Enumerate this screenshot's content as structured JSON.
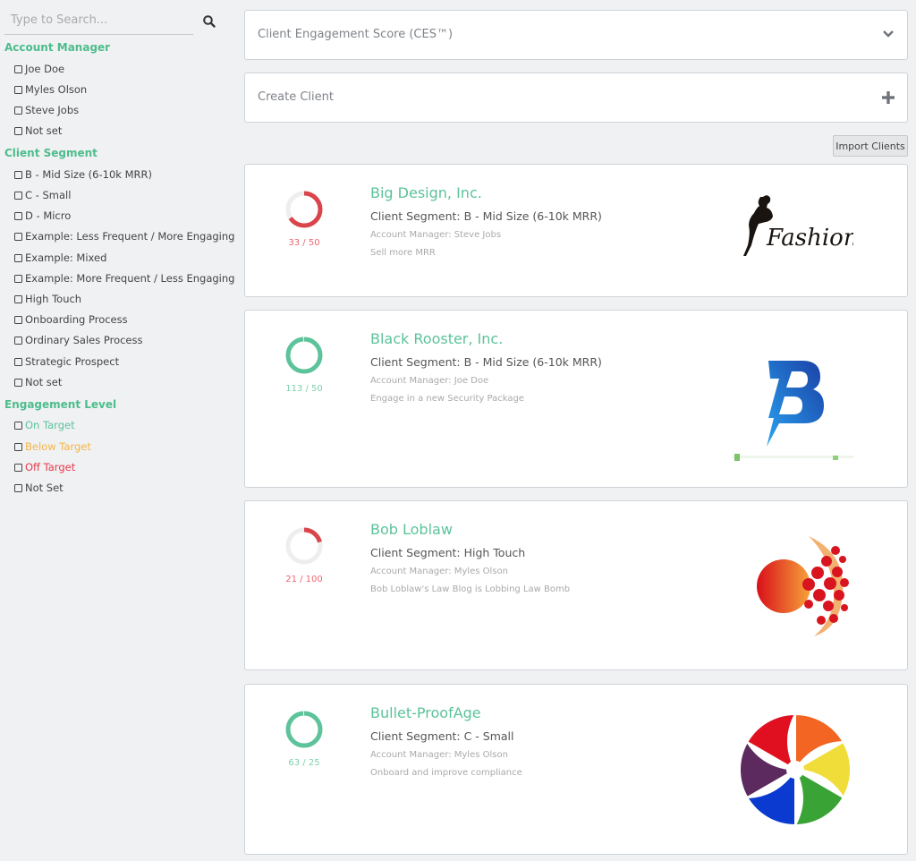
{
  "search": {
    "placeholder": "Type to Search..."
  },
  "filters": {
    "account_manager": {
      "title": "Account Manager",
      "items": [
        "Joe Doe",
        "Myles Olson",
        "Steve Jobs",
        "Not set"
      ]
    },
    "client_segment": {
      "title": "Client Segment",
      "items": [
        "B - Mid Size (6-10k MRR)",
        "C - Small",
        "D - Micro",
        "Example: Less Frequent / More Engaging",
        "Example: Mixed",
        "Example: More Frequent / Less Engaging",
        "High Touch",
        "Onboarding Process",
        "Ordinary Sales Process",
        "Strategic Prospect",
        "Not set"
      ]
    },
    "engagement_level": {
      "title": "Engagement Level",
      "items": [
        "On Target",
        "Below Target",
        "Off Target",
        "Not Set"
      ]
    }
  },
  "panels": {
    "ces_title": "Client Engagement Score (CES™)",
    "create_title": "Create Client",
    "import_label": "Import Clients"
  },
  "colors": {
    "accent_green": "#5cc39a",
    "off_red": "#d9454b",
    "below_orange": "#f5b544",
    "track_gray": "#eeeeee"
  },
  "clients": [
    {
      "name": "Big Design, Inc.",
      "segment": "Client Segment: B - Mid Size (6-10k MRR)",
      "manager": "Account Manager: Steve Jobs",
      "goal": "Sell more MRR",
      "score": 33,
      "target": 50,
      "score_text": "33 / 50",
      "status": "off",
      "logo": "fashion-logo"
    },
    {
      "name": "Black Rooster, Inc.",
      "segment": "Client Segment: B - Mid Size (6-10k MRR)",
      "manager": "Account Manager: Joe Doe",
      "goal": "Engage in a new Security Package",
      "score": 113,
      "target": 50,
      "score_text": "113 / 50",
      "status": "on",
      "logo": "lightning-b-logo"
    },
    {
      "name": "Bob Loblaw",
      "segment": "Client Segment: High Touch",
      "manager": "Account Manager: Myles Olson",
      "goal": "Bob Loblaw's Law Blog is Lobbing Law Bomb",
      "score": 21,
      "target": 100,
      "score_text": "21 / 100",
      "status": "off",
      "logo": "red-sphere-logo"
    },
    {
      "name": "Bullet-ProofAge",
      "segment": "Client Segment: C - Small",
      "manager": "Account Manager: Myles Olson",
      "goal": "Onboard and improve compliance",
      "score": 63,
      "target": 25,
      "score_text": "63 / 25",
      "status": "on",
      "logo": "rainbow-swirl-logo"
    }
  ]
}
